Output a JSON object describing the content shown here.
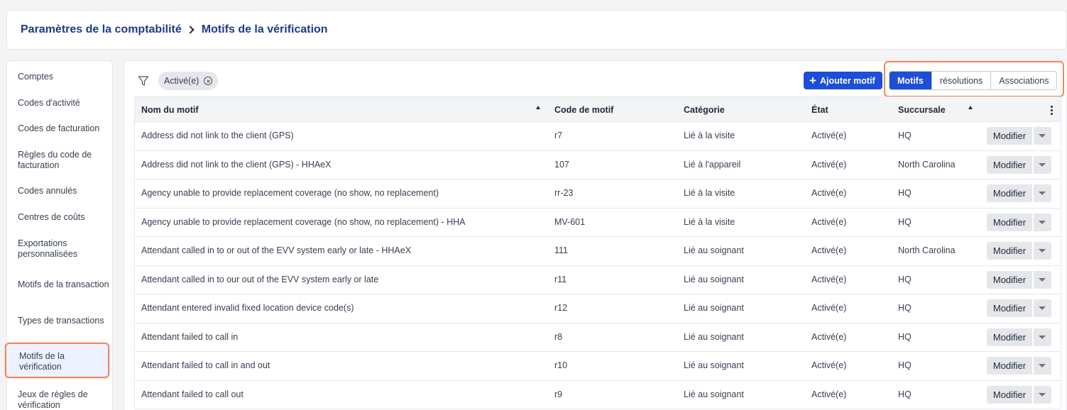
{
  "breadcrumb": {
    "parent": "Paramètres de la comptabilité",
    "current": "Motifs de la vérification"
  },
  "sidebar": {
    "items": [
      {
        "label": "Comptes"
      },
      {
        "label": "Codes d'activité"
      },
      {
        "label": "Codes de facturation"
      },
      {
        "label": "Règles du code de facturation"
      },
      {
        "label": "Codes annulés"
      },
      {
        "label": "Centres de coûts"
      },
      {
        "label": "Exportations personnalisées"
      },
      {
        "label": "Motifs de la transaction"
      },
      {
        "label": "Types de transactions"
      },
      {
        "label": "Motifs de la vérification",
        "active": true
      },
      {
        "label": "Jeux de règles de vérification"
      }
    ]
  },
  "toolbar": {
    "filter_icon": "filter-icon",
    "chip_label": "Activé(e)",
    "add_label": "Ajouter motif",
    "segments": [
      "Motifs",
      "résolutions",
      "Associations"
    ],
    "active_segment": "Motifs",
    "accent_color": "#1d4ed8"
  },
  "table": {
    "headers": [
      "Nom du motif",
      "Code de motif",
      "Catégorie",
      "État",
      "Succursale"
    ],
    "edit_label": "Modifier",
    "rows": [
      {
        "name": "Address did not link to the client (GPS)",
        "code": "r7",
        "category": "Lié à la visite",
        "state": "Activé(e)",
        "branch": "HQ"
      },
      {
        "name": "Address did not link to the client (GPS) - HHAeX",
        "code": "107",
        "category": "Lié à l'appareil",
        "state": "Activé(e)",
        "branch": "North Carolina"
      },
      {
        "name": "Agency unable to provide replacement coverage (no show, no replacement)",
        "code": "rr-23",
        "category": "Lié à la visite",
        "state": "Activé(e)",
        "branch": "HQ"
      },
      {
        "name": "Agency unable to provide replacement coverage (no show, no replacement) - HHA",
        "code": "MV-601",
        "category": "Lié à la visite",
        "state": "Activé(e)",
        "branch": "HQ"
      },
      {
        "name": "Attendant called in to or out of the EVV system early or late - HHAeX",
        "code": "111",
        "category": "Lié au soignant",
        "state": "Activé(e)",
        "branch": "North Carolina"
      },
      {
        "name": "Attendant called in to our out of the EVV system early or late",
        "code": "r11",
        "category": "Lié au soignant",
        "state": "Activé(e)",
        "branch": "HQ"
      },
      {
        "name": "Attendant entered invalid fixed location device code(s)",
        "code": "r12",
        "category": "Lié au soignant",
        "state": "Activé(e)",
        "branch": "HQ"
      },
      {
        "name": "Attendant failed to call in",
        "code": "r8",
        "category": "Lié au soignant",
        "state": "Activé(e)",
        "branch": "HQ"
      },
      {
        "name": "Attendant failed to call in and out",
        "code": "r10",
        "category": "Lié au soignant",
        "state": "Activé(e)",
        "branch": "HQ"
      },
      {
        "name": "Attendant failed to call out",
        "code": "r9",
        "category": "Lié au soignant",
        "state": "Activé(e)",
        "branch": "HQ"
      }
    ]
  }
}
